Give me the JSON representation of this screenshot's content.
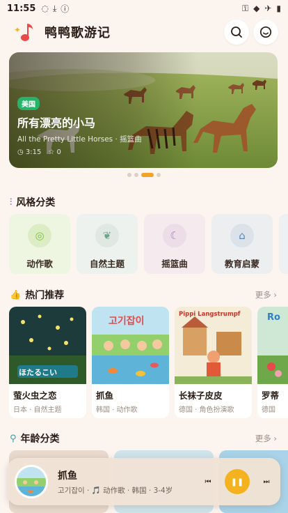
{
  "status_bar": {
    "time": "11:55"
  },
  "app": {
    "title": "鸭鸭歌游记"
  },
  "banner": {
    "tag": "美国",
    "title": "所有漂亮的小马",
    "subtitle": "All the Pretty Little Horses · 摇篮曲",
    "duration": "3:15",
    "stars": "0",
    "page_count": 4,
    "active_page": 2
  },
  "styles": {
    "title": "风格分类",
    "items": [
      {
        "label": "动作歌",
        "icon": "basketball-icon",
        "bg": "#eef6e2",
        "icon_bg": "#dcedc6",
        "icon_color": "#7cbf3f"
      },
      {
        "label": "自然主题",
        "icon": "leaf-icon",
        "bg": "#eef2ee",
        "icon_bg": "#dfe9e2",
        "icon_color": "#6fa38a"
      },
      {
        "label": "摇篮曲",
        "icon": "moon-icon",
        "bg": "#f5ebef",
        "icon_bg": "#ecdde6",
        "icon_color": "#a287b8"
      },
      {
        "label": "教育启蒙",
        "icon": "graduation-cap-icon",
        "bg": "#eceef0",
        "icon_bg": "#dbe2ea",
        "icon_color": "#5a86b5"
      }
    ]
  },
  "hot": {
    "title": "热门推荐",
    "more": "更多",
    "items": [
      {
        "name": "萤火虫之恋",
        "meta": "日本 · 自然主题",
        "cover_text": "ほたるこい"
      },
      {
        "name": "抓鱼",
        "meta": "韩国 · 动作歌",
        "cover_text": "고기잡이"
      },
      {
        "name": "长袜子皮皮",
        "meta": "德国 · 角色扮演歌",
        "cover_text": "Pippi Langstrumpf"
      },
      {
        "name": "罗蒂",
        "meta": "德国",
        "cover_text": "Ro"
      }
    ]
  },
  "age": {
    "title": "年龄分类",
    "more": "更多"
  },
  "player": {
    "title": "抓鱼",
    "subtitle": "고기잡이 · 🎵 动作歌 · 韩国 · 3-4岁"
  }
}
